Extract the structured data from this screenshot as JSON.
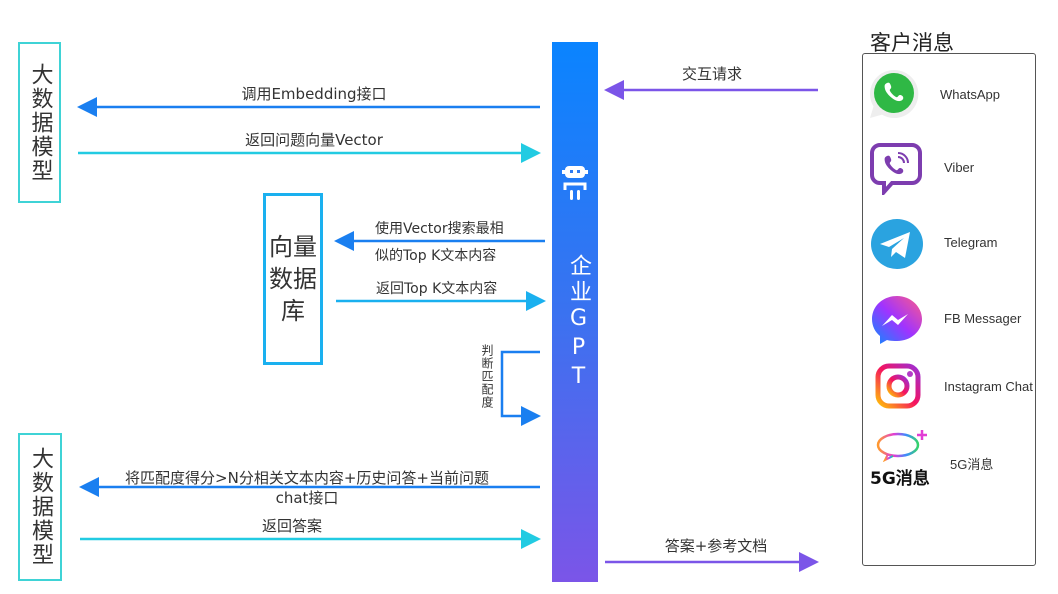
{
  "colors": {
    "blue_arrow": "#1a7ff0",
    "cyan_arrow": "#22cbe2",
    "purple_arrow": "#7b55e8",
    "gpt_top": "#0a84ff",
    "gpt_bottom": "#7b55e8",
    "model_border": "#3fd3d6",
    "db_border": "#1ab0ef"
  },
  "model_top": {
    "label": "大数据模型"
  },
  "model_bottom": {
    "label": "大数据模型"
  },
  "vector_db": {
    "label": "向量数据库"
  },
  "gpt": {
    "label": "企业GPT",
    "icon": "robot-icon"
  },
  "arrows": {
    "embedding": "调用Embedding接口",
    "return_vector": "返回问题向量Vector",
    "search_line1": "使用Vector搜索最相",
    "search_line2": "似的Top K文本内容",
    "return_topk": "返回Top K文本内容",
    "judge_match": "判断匹配度",
    "chat_line1": "将匹配度得分>N分相关文本内容+历史问答+当前问题",
    "chat_line2": "chat接口",
    "return_answer": "返回答案",
    "interaction_request": "交互请求",
    "answer_docs": "答案+参考文档"
  },
  "customer": {
    "title": "客户消息",
    "items": [
      {
        "label": "WhatsApp",
        "icon": "whatsapp-icon"
      },
      {
        "label": "Viber",
        "icon": "viber-icon"
      },
      {
        "label": "Telegram",
        "icon": "telegram-icon"
      },
      {
        "label": "FB Messager",
        "icon": "messenger-icon"
      },
      {
        "label": "Instagram Chat",
        "icon": "instagram-icon"
      },
      {
        "label": "5G消息",
        "icon": "5g-message-icon",
        "logo_text": "5G消息"
      }
    ]
  }
}
